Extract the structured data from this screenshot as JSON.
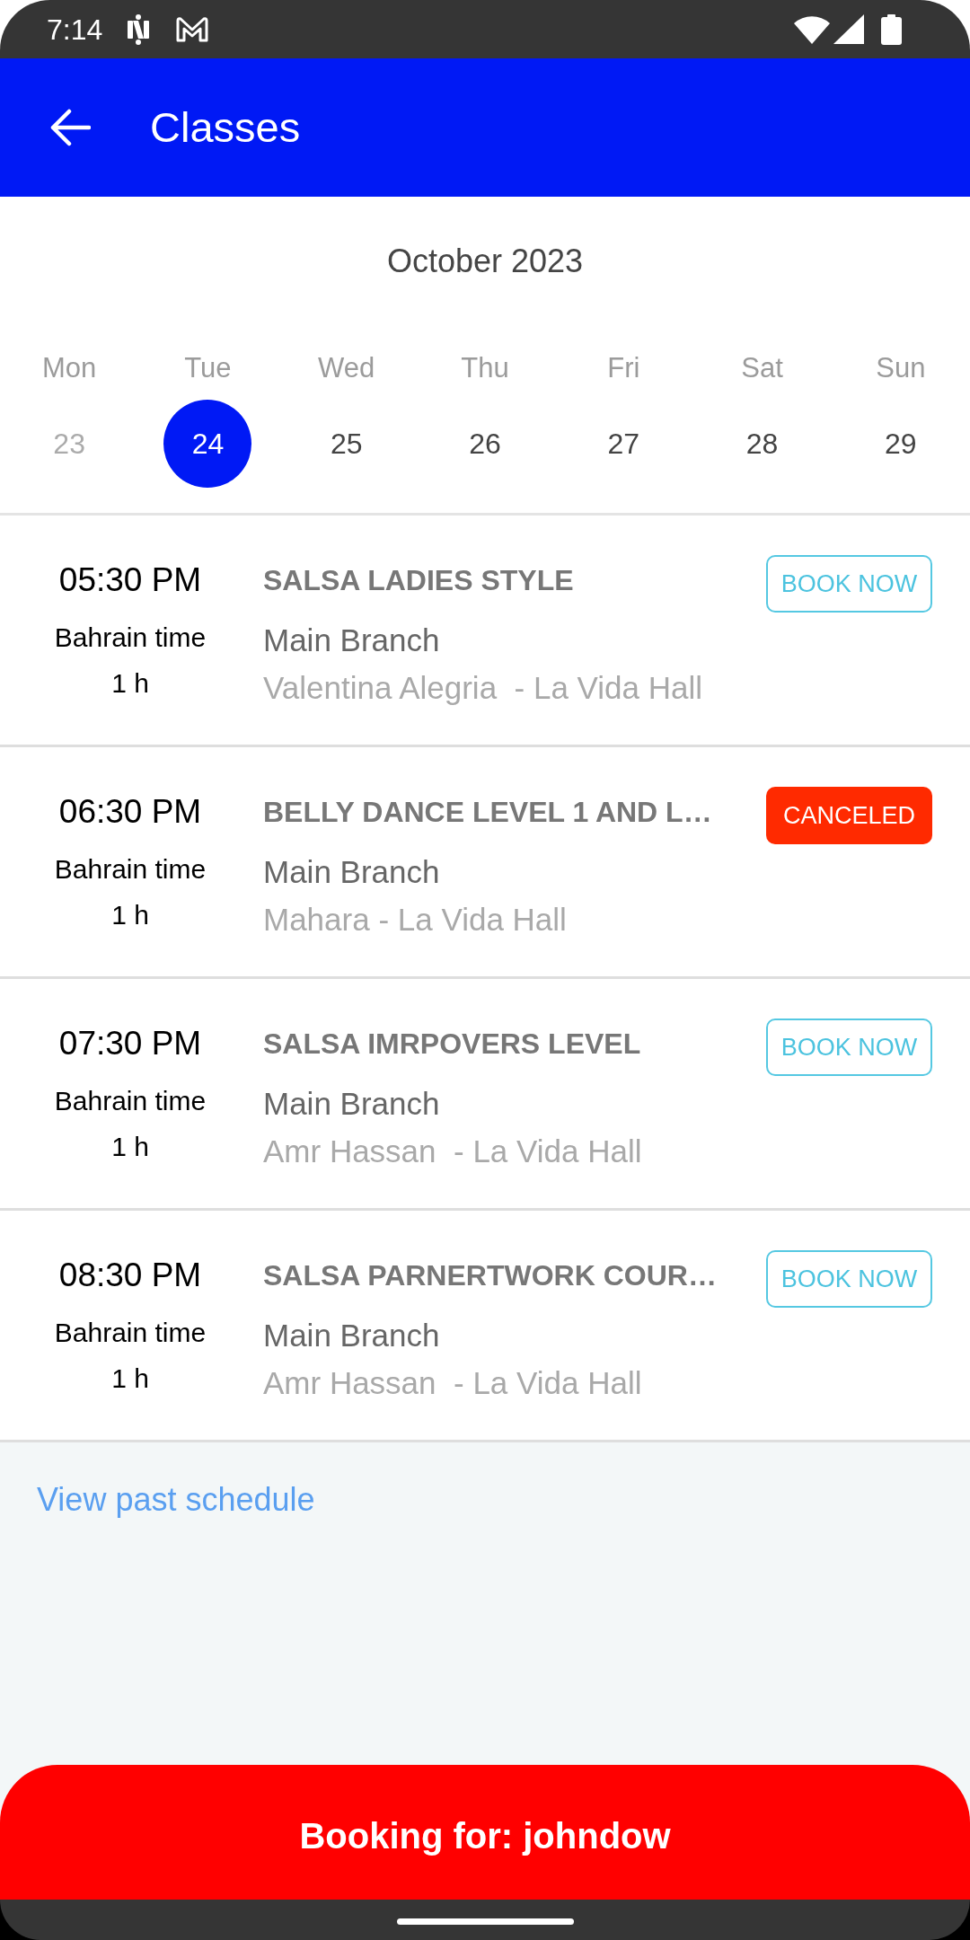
{
  "status_bar": {
    "time": "7:14"
  },
  "app_bar": {
    "title": "Classes"
  },
  "calendar": {
    "month": "October 2023",
    "days": [
      {
        "weekday": "Mon",
        "date": "23",
        "selected": false,
        "disabled": true
      },
      {
        "weekday": "Tue",
        "date": "24",
        "selected": true,
        "disabled": false
      },
      {
        "weekday": "Wed",
        "date": "25",
        "selected": false,
        "disabled": false
      },
      {
        "weekday": "Thu",
        "date": "26",
        "selected": false,
        "disabled": false
      },
      {
        "weekday": "Fri",
        "date": "27",
        "selected": false,
        "disabled": false
      },
      {
        "weekday": "Sat",
        "date": "28",
        "selected": false,
        "disabled": false
      },
      {
        "weekday": "Sun",
        "date": "29",
        "selected": false,
        "disabled": false
      }
    ]
  },
  "classes": [
    {
      "time": "05:30 PM",
      "timezone": "Bahrain time",
      "duration": "1 h",
      "title": "SALSA LADIES STYLE",
      "branch": "Main Branch",
      "details": "Valentina Alegria  - La Vida Hall",
      "action": {
        "kind": "book",
        "label": "BOOK NOW"
      }
    },
    {
      "time": "06:30 PM",
      "timezone": "Bahrain time",
      "duration": "1 h",
      "title": "BELLY DANCE LEVEL 1 AND L…",
      "branch": "Main Branch",
      "details": "Mahara - La Vida Hall",
      "action": {
        "kind": "canceled",
        "label": "CANCELED"
      }
    },
    {
      "time": "07:30 PM",
      "timezone": "Bahrain time",
      "duration": "1 h",
      "title": "SALSA IMRPOVERS LEVEL",
      "branch": "Main Branch",
      "details": "Amr Hassan  - La Vida Hall",
      "action": {
        "kind": "book",
        "label": "BOOK NOW"
      }
    },
    {
      "time": "08:30 PM",
      "timezone": "Bahrain time",
      "duration": "1 h",
      "title": "SALSA PARNERTWORK COUR…",
      "branch": "Main Branch",
      "details": "Amr Hassan  - La Vida Hall",
      "action": {
        "kind": "book",
        "label": "BOOK NOW"
      }
    }
  ],
  "past_schedule_link": "View past schedule",
  "booking_button": {
    "label": "Booking for: johndow"
  }
}
